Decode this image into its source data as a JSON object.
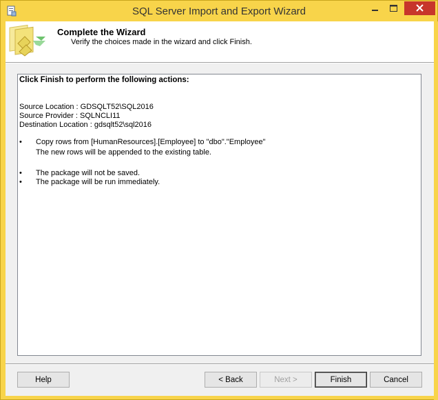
{
  "window": {
    "title": "SQL Server Import and Export Wizard",
    "accent_color": "#f8d44a",
    "close_color": "#c7362b"
  },
  "header": {
    "title": "Complete the Wizard",
    "subtitle": "Verify the choices made in the wizard and click Finish.",
    "icon": "wizard-icon"
  },
  "summary": {
    "heading": "Click Finish to perform the following actions:",
    "source_location": "Source Location : GDSQLT52\\SQL2016",
    "source_provider": "Source Provider : SQLNCLI11",
    "destination_location": "Destination Location : gdsqlt52\\sql2016",
    "bullet_char": "•",
    "actions": [
      {
        "text": "Copy rows from [HumanResources].[Employee] to \"dbo\".\"Employee\"",
        "detail": "The new rows will be appended to the existing table."
      },
      {
        "text": "The package will not be saved."
      },
      {
        "text": "The package will be run immediately."
      }
    ]
  },
  "buttons": {
    "help": "Help",
    "back": "< Back",
    "next": "Next >",
    "finish": "Finish",
    "cancel": "Cancel"
  }
}
